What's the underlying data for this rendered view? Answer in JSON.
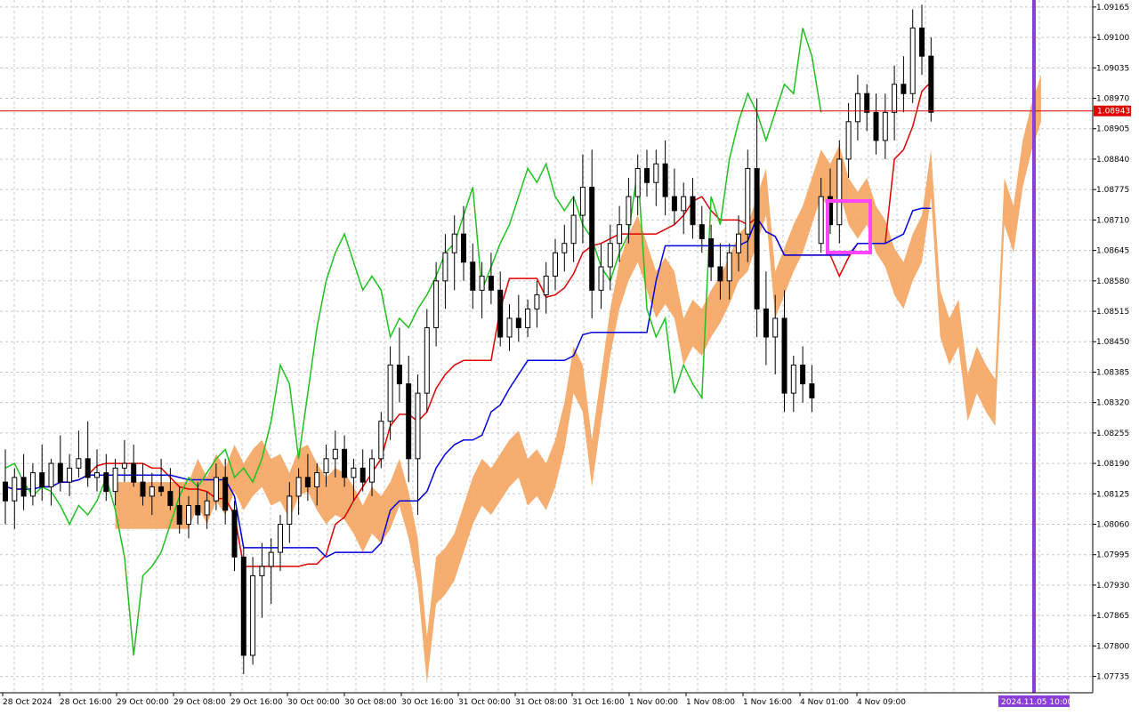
{
  "chart_data": {
    "type": "candlestick",
    "instrument_note": "",
    "y_ticks": [
      "1.09165",
      "1.09100",
      "1.09035",
      "1.08970",
      "1.08905",
      "1.08840",
      "1.08775",
      "1.08710",
      "1.08645",
      "1.08580",
      "1.08515",
      "1.08450",
      "1.08385",
      "1.08320",
      "1.08255",
      "1.08190",
      "1.08125",
      "1.08060",
      "1.07995",
      "1.07930",
      "1.07865",
      "1.07800",
      "1.07735"
    ],
    "x_ticks": [
      "28 Oct 2024",
      "28 Oct 16:00",
      "29 Oct 00:00",
      "29 Oct 08:00",
      "29 Oct 16:00",
      "30 Oct 00:00",
      "30 Oct 08:00",
      "30 Oct 16:00",
      "31 Oct 00:00",
      "31 Oct 08:00",
      "31 Oct 16:00",
      "1 Nov 00:00",
      "1 Nov 08:00",
      "1 Nov 16:00",
      "4 Nov 01:00",
      "4 Nov 09:00"
    ],
    "ylim": [
      1.077,
      1.0918
    ],
    "current_price": {
      "label": "1.08943",
      "value": 1.08943,
      "color": "#e00000"
    },
    "future_marker": {
      "label": "2024.11.05 10:00",
      "color": "#8a3fd8"
    },
    "highlight_box": {
      "color": "#ff44ff"
    },
    "grid": true,
    "colors": {
      "bull_body": "#ffffff",
      "bear_body": "#000000",
      "tenkan": "#e00000",
      "kijun": "#0000e0",
      "chikou": "#20c020",
      "cloud_bull": "#f4a460",
      "cloud_bear": "#d8bfd8",
      "span_a_line": "#ff66cc",
      "span_b_line": "#006400"
    },
    "candles": [
      [
        1.0815,
        1.0822,
        1.0806,
        1.0811
      ],
      [
        1.0811,
        1.0818,
        1.0805,
        1.0816
      ],
      [
        1.0816,
        1.0821,
        1.0809,
        1.0812
      ],
      [
        1.0812,
        1.0819,
        1.081,
        1.0817
      ],
      [
        1.0817,
        1.0823,
        1.0811,
        1.0814
      ],
      [
        1.0814,
        1.082,
        1.081,
        1.0819
      ],
      [
        1.0819,
        1.0825,
        1.0813,
        1.0815
      ],
      [
        1.0815,
        1.0821,
        1.0812,
        1.0818
      ],
      [
        1.0818,
        1.0826,
        1.0816,
        1.082
      ],
      [
        1.082,
        1.0828,
        1.0814,
        1.0816
      ],
      [
        1.0816,
        1.0822,
        1.0813,
        1.0817
      ],
      [
        1.0817,
        1.0821,
        1.0811,
        1.0813
      ],
      [
        1.0813,
        1.082,
        1.081,
        1.0818
      ],
      [
        1.0818,
        1.0824,
        1.0815,
        1.0819
      ],
      [
        1.0819,
        1.0823,
        1.0814,
        1.0815
      ],
      [
        1.0815,
        1.0819,
        1.081,
        1.0812
      ],
      [
        1.0812,
        1.0817,
        1.0808,
        1.0814
      ],
      [
        1.0814,
        1.082,
        1.0812,
        1.0813
      ],
      [
        1.0813,
        1.0818,
        1.0809,
        1.081
      ],
      [
        1.081,
        1.0814,
        1.0804,
        1.0806
      ],
      [
        1.0806,
        1.0812,
        1.0803,
        1.081
      ],
      [
        1.081,
        1.0815,
        1.0806,
        1.0808
      ],
      [
        1.0808,
        1.0813,
        1.0805,
        1.0811
      ],
      [
        1.0811,
        1.0819,
        1.0809,
        1.0816
      ],
      [
        1.0816,
        1.082,
        1.0806,
        1.0809
      ],
      [
        1.0809,
        1.0811,
        1.0796,
        1.0799
      ],
      [
        1.0799,
        1.0801,
        1.0774,
        1.0778
      ],
      [
        1.0778,
        1.0799,
        1.0776,
        1.0795
      ],
      [
        1.0795,
        1.0802,
        1.0786,
        1.0797
      ],
      [
        1.0797,
        1.0803,
        1.0789,
        1.08
      ],
      [
        1.08,
        1.0808,
        1.0796,
        1.0806
      ],
      [
        1.0806,
        1.0815,
        1.0802,
        1.0812
      ],
      [
        1.0812,
        1.0818,
        1.0808,
        1.0816
      ],
      [
        1.0816,
        1.0821,
        1.0811,
        1.0814
      ],
      [
        1.0814,
        1.0819,
        1.081,
        1.0817
      ],
      [
        1.0817,
        1.0823,
        1.0814,
        1.082
      ],
      [
        1.082,
        1.0826,
        1.0816,
        1.0822
      ],
      [
        1.0822,
        1.0825,
        1.0814,
        1.0816
      ],
      [
        1.0816,
        1.082,
        1.0811,
        1.0818
      ],
      [
        1.0818,
        1.0822,
        1.0813,
        1.0815
      ],
      [
        1.0815,
        1.0822,
        1.0812,
        1.082
      ],
      [
        1.082,
        1.083,
        1.0818,
        1.0828
      ],
      [
        1.0828,
        1.0844,
        1.0824,
        1.084
      ],
      [
        1.084,
        1.0848,
        1.0832,
        1.0836
      ],
      [
        1.0836,
        1.0842,
        1.0815,
        1.082
      ],
      [
        1.082,
        1.0838,
        1.0808,
        1.0834
      ],
      [
        1.0834,
        1.0852,
        1.083,
        1.0848
      ],
      [
        1.0848,
        1.0862,
        1.0844,
        1.0858
      ],
      [
        1.0858,
        1.0868,
        1.0852,
        1.0864
      ],
      [
        1.0864,
        1.0872,
        1.0856,
        1.0868
      ],
      [
        1.0868,
        1.0874,
        1.0858,
        1.0862
      ],
      [
        1.0862,
        1.0866,
        1.0852,
        1.0856
      ],
      [
        1.0856,
        1.0862,
        1.085,
        1.0859
      ],
      [
        1.0859,
        1.0864,
        1.0853,
        1.0856
      ],
      [
        1.0856,
        1.086,
        1.0844,
        1.0846
      ],
      [
        1.0846,
        1.0853,
        1.0843,
        1.085
      ],
      [
        1.085,
        1.0855,
        1.0845,
        1.0848
      ],
      [
        1.0848,
        1.0854,
        1.0846,
        1.0852
      ],
      [
        1.0852,
        1.0858,
        1.0848,
        1.0855
      ],
      [
        1.0855,
        1.0862,
        1.0851,
        1.0859
      ],
      [
        1.0859,
        1.0867,
        1.0856,
        1.0864
      ],
      [
        1.0864,
        1.087,
        1.086,
        1.0866
      ],
      [
        1.0866,
        1.0876,
        1.0862,
        1.0872
      ],
      [
        1.0872,
        1.0885,
        1.0866,
        1.0878
      ],
      [
        1.0878,
        1.0886,
        1.085,
        1.0856
      ],
      [
        1.0856,
        1.0866,
        1.0852,
        1.0861
      ],
      [
        1.0861,
        1.087,
        1.0856,
        1.0866
      ],
      [
        1.0866,
        1.0874,
        1.0862,
        1.087
      ],
      [
        1.087,
        1.088,
        1.0866,
        1.0876
      ],
      [
        1.0876,
        1.0885,
        1.0872,
        1.0882
      ],
      [
        1.0882,
        1.0886,
        1.0876,
        1.0879
      ],
      [
        1.0879,
        1.0886,
        1.0874,
        1.0883
      ],
      [
        1.0883,
        1.0888,
        1.0872,
        1.0876
      ],
      [
        1.0876,
        1.0882,
        1.087,
        1.0873
      ],
      [
        1.0873,
        1.0879,
        1.0868,
        1.0876
      ],
      [
        1.0876,
        1.088,
        1.0867,
        1.087
      ],
      [
        1.087,
        1.0874,
        1.0864,
        1.0867
      ],
      [
        1.0867,
        1.087,
        1.0858,
        1.0861
      ],
      [
        1.0861,
        1.0866,
        1.0854,
        1.0858
      ],
      [
        1.0858,
        1.0866,
        1.0854,
        1.0864
      ],
      [
        1.0864,
        1.0872,
        1.086,
        1.0868
      ],
      [
        1.0868,
        1.0886,
        1.0862,
        1.0882
      ],
      [
        1.0882,
        1.0897,
        1.0846,
        1.0852
      ],
      [
        1.0852,
        1.086,
        1.084,
        1.0846
      ],
      [
        1.0846,
        1.0855,
        1.0838,
        1.085
      ],
      [
        1.085,
        1.0856,
        1.083,
        1.0834
      ],
      [
        1.0834,
        1.0842,
        1.083,
        1.084
      ],
      [
        1.084,
        1.0844,
        1.0832,
        1.0836
      ],
      [
        1.0836,
        1.084,
        1.083,
        1.0833
      ],
      [
        1.0866,
        1.088,
        1.0864,
        1.0876
      ],
      [
        1.0876,
        1.0882,
        1.0868,
        1.087
      ],
      [
        1.087,
        1.0888,
        1.0866,
        1.0884
      ],
      [
        1.0884,
        1.0896,
        1.088,
        1.0892
      ],
      [
        1.0892,
        1.0902,
        1.0888,
        1.0898
      ],
      [
        1.0898,
        1.09,
        1.089,
        1.0894
      ],
      [
        1.0894,
        1.0898,
        1.0885,
        1.0888
      ],
      [
        1.0888,
        1.0898,
        1.0884,
        1.0894
      ],
      [
        1.0894,
        1.0904,
        1.0888,
        1.09
      ],
      [
        1.09,
        1.0906,
        1.0894,
        1.0898
      ],
      [
        1.0898,
        1.0916,
        1.0896,
        1.0912
      ],
      [
        1.0912,
        1.0917,
        1.0902,
        1.0906
      ],
      [
        1.0906,
        1.091,
        1.0892,
        1.0894
      ]
    ]
  },
  "axis": {
    "price_label": "1.08943",
    "time_label": "2024.11.05 10:00"
  }
}
